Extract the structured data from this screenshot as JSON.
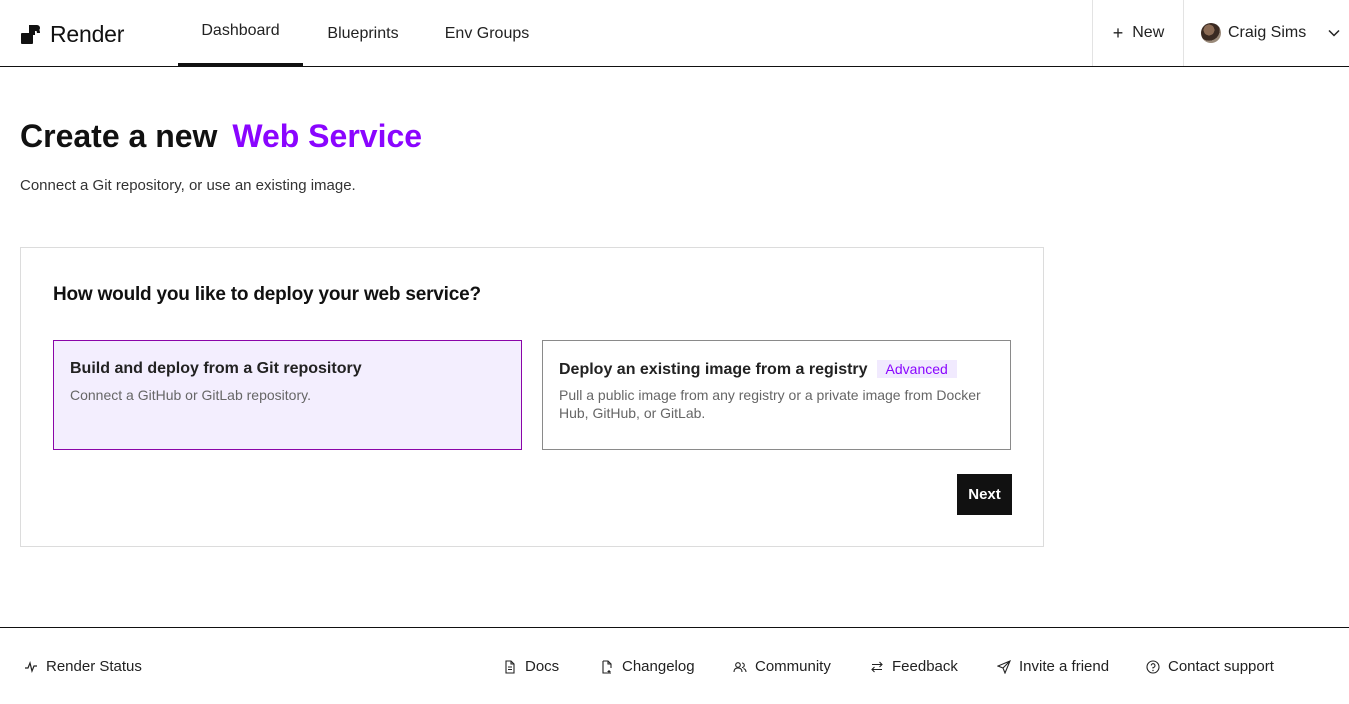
{
  "app": {
    "name": "Render"
  },
  "nav": {
    "tabs": [
      {
        "label": "Dashboard",
        "active": true
      },
      {
        "label": "Blueprints",
        "active": false
      },
      {
        "label": "Env Groups",
        "active": false
      }
    ],
    "new_label": "New",
    "user_name": "Craig Sims"
  },
  "main": {
    "title_prefix": "Create a new",
    "title_accent": "Web Service",
    "subtitle": "Connect a Git repository, or use an existing image.",
    "question": "How would you like to deploy your web service?",
    "options": [
      {
        "title": "Build and deploy from a Git repository",
        "description": "Connect a GitHub or GitLab repository.",
        "selected": true
      },
      {
        "title": "Deploy an existing image from a registry",
        "badge": "Advanced",
        "description": "Pull a public image from any registry or a private image from Docker Hub, GitHub, or GitLab.",
        "selected": false
      }
    ],
    "next_label": "Next"
  },
  "footer": {
    "links": [
      {
        "label": "Render Status",
        "icon": "activity-icon"
      },
      {
        "label": "Docs",
        "icon": "document-icon"
      },
      {
        "label": "Changelog",
        "icon": "changelog-icon"
      },
      {
        "label": "Community",
        "icon": "people-icon"
      },
      {
        "label": "Feedback",
        "icon": "swap-arrows-icon"
      },
      {
        "label": "Invite a friend",
        "icon": "send-icon"
      },
      {
        "label": "Contact support",
        "icon": "help-circle-icon"
      }
    ]
  },
  "colors": {
    "accent": "#8a05ff",
    "selected_bg": "#f3eefe",
    "text": "#111111"
  }
}
